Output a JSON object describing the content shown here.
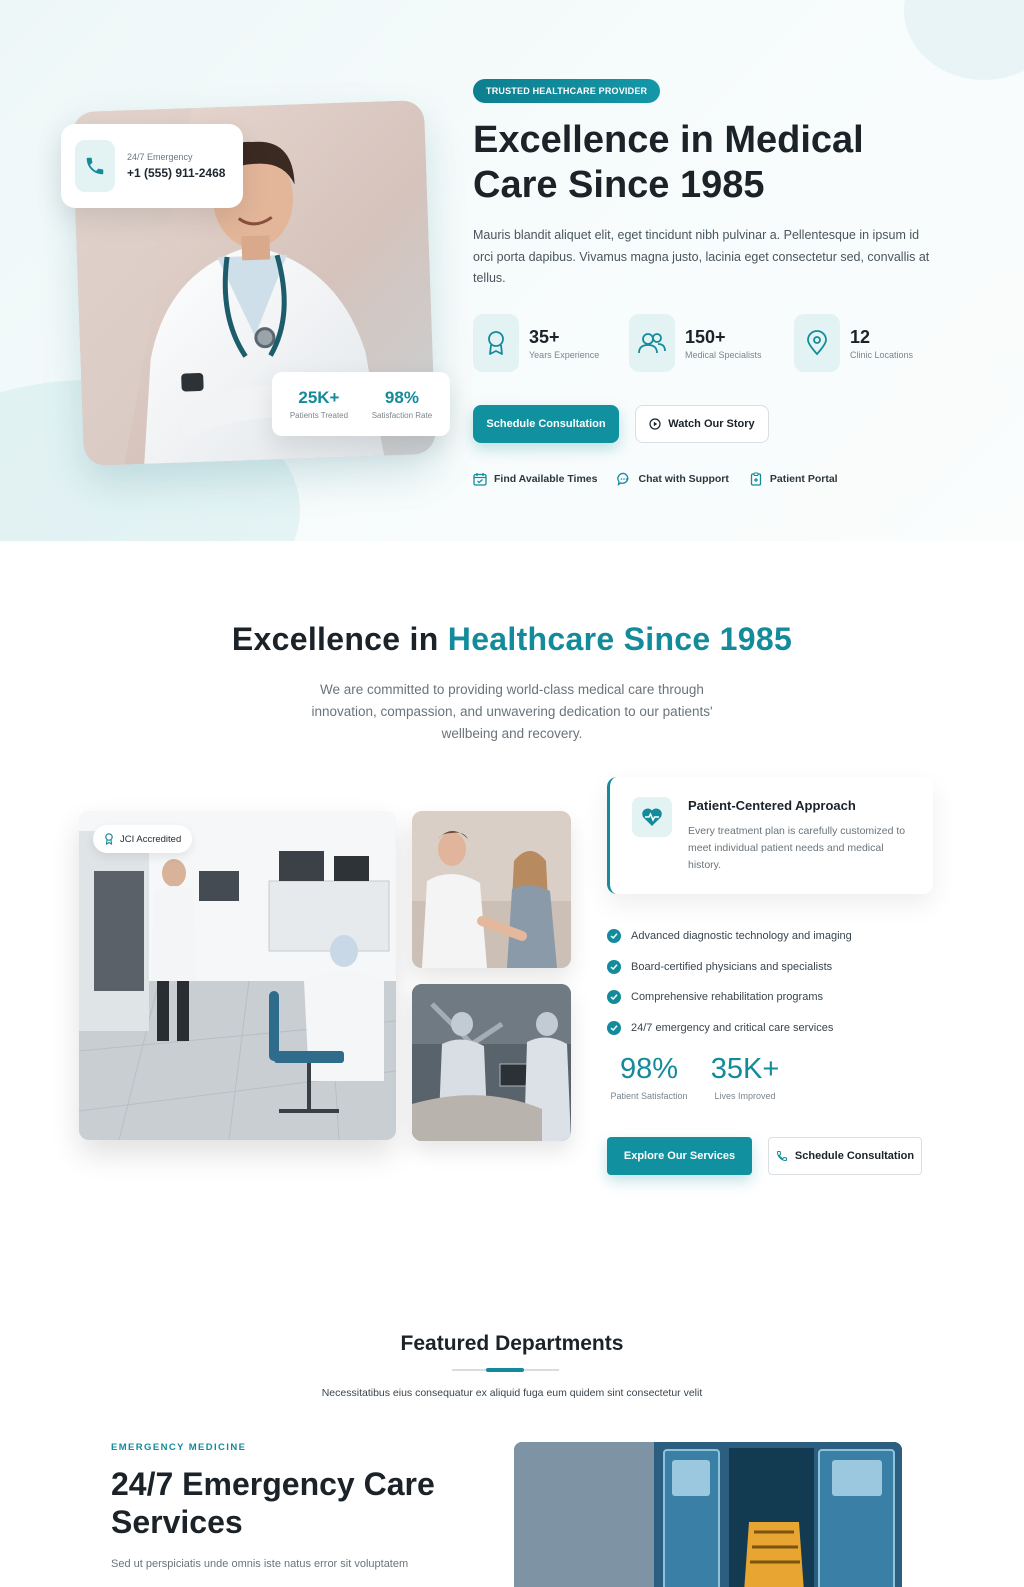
{
  "hero": {
    "badge": "TRUSTED HEALTHCARE PROVIDER",
    "title_line1": "Excellence in Medical",
    "title_line2": "Care Since 1985",
    "description": "Mauris blandit aliquet elit, eget tincidunt nibh pulvinar a. Pellentesque in ipsum id orci porta dapibus. Vivamus magna justo, lacinia eget consectetur sed, convallis at tellus.",
    "emergency_label": "24/7 Emergency",
    "emergency_number": "+1 (555) 911-2468",
    "mini_stats": [
      {
        "value": "25K+",
        "label": "Patients Treated"
      },
      {
        "value": "98%",
        "label": "Satisfaction Rate"
      }
    ],
    "stats": [
      {
        "value": "35+",
        "label": "Years Experience",
        "icon": "award-icon"
      },
      {
        "value": "150+",
        "label": "Medical Specialists",
        "icon": "users-icon"
      },
      {
        "value": "12",
        "label": "Clinic Locations",
        "icon": "map-pin-icon"
      }
    ],
    "primary_button": "Schedule Consultation",
    "secondary_button": "Watch Our Story",
    "quick_links": [
      {
        "label": "Find Available Times",
        "icon": "calendar-icon"
      },
      {
        "label": "Chat with Support",
        "icon": "chat-icon"
      },
      {
        "label": "Patient Portal",
        "icon": "clipboard-icon"
      }
    ]
  },
  "about": {
    "title_start": "Excellence in ",
    "title_accent": "Healthcare Since 1985",
    "description": "We are committed to providing world-class medical care through innovation, compassion, and unwavering dedication to our patients' wellbeing and recovery.",
    "badge": "JCI Accredited",
    "card_title": "Patient-Centered Approach",
    "card_text": "Every treatment plan is carefully customized to meet individual patient needs and medical history.",
    "checklist": [
      "Advanced diagnostic technology and imaging",
      "Board-certified physicians and specialists",
      "Comprehensive rehabilitation programs",
      "24/7 emergency and critical care services"
    ],
    "stats": [
      {
        "value": "98%",
        "label": "Patient Satisfaction"
      },
      {
        "value": "35K+",
        "label": "Lives Improved"
      }
    ],
    "primary_button": "Explore Our Services",
    "secondary_button": "Schedule Consultation"
  },
  "departments": {
    "title": "Featured Departments",
    "description": "Necessitatibus eius consequatur ex aliquid fuga eum quidem sint consectetur velit",
    "eyebrow": "EMERGENCY MEDICINE",
    "feature_title": "24/7 Emergency Care Services",
    "feature_text": "Sed ut perspiciatis unde omnis iste natus error sit voluptatem"
  },
  "colors": {
    "accent": "#148b9b",
    "accent_dark": "#0d7f8f",
    "text_dark": "#1b2228",
    "text_muted": "#6a747b"
  }
}
